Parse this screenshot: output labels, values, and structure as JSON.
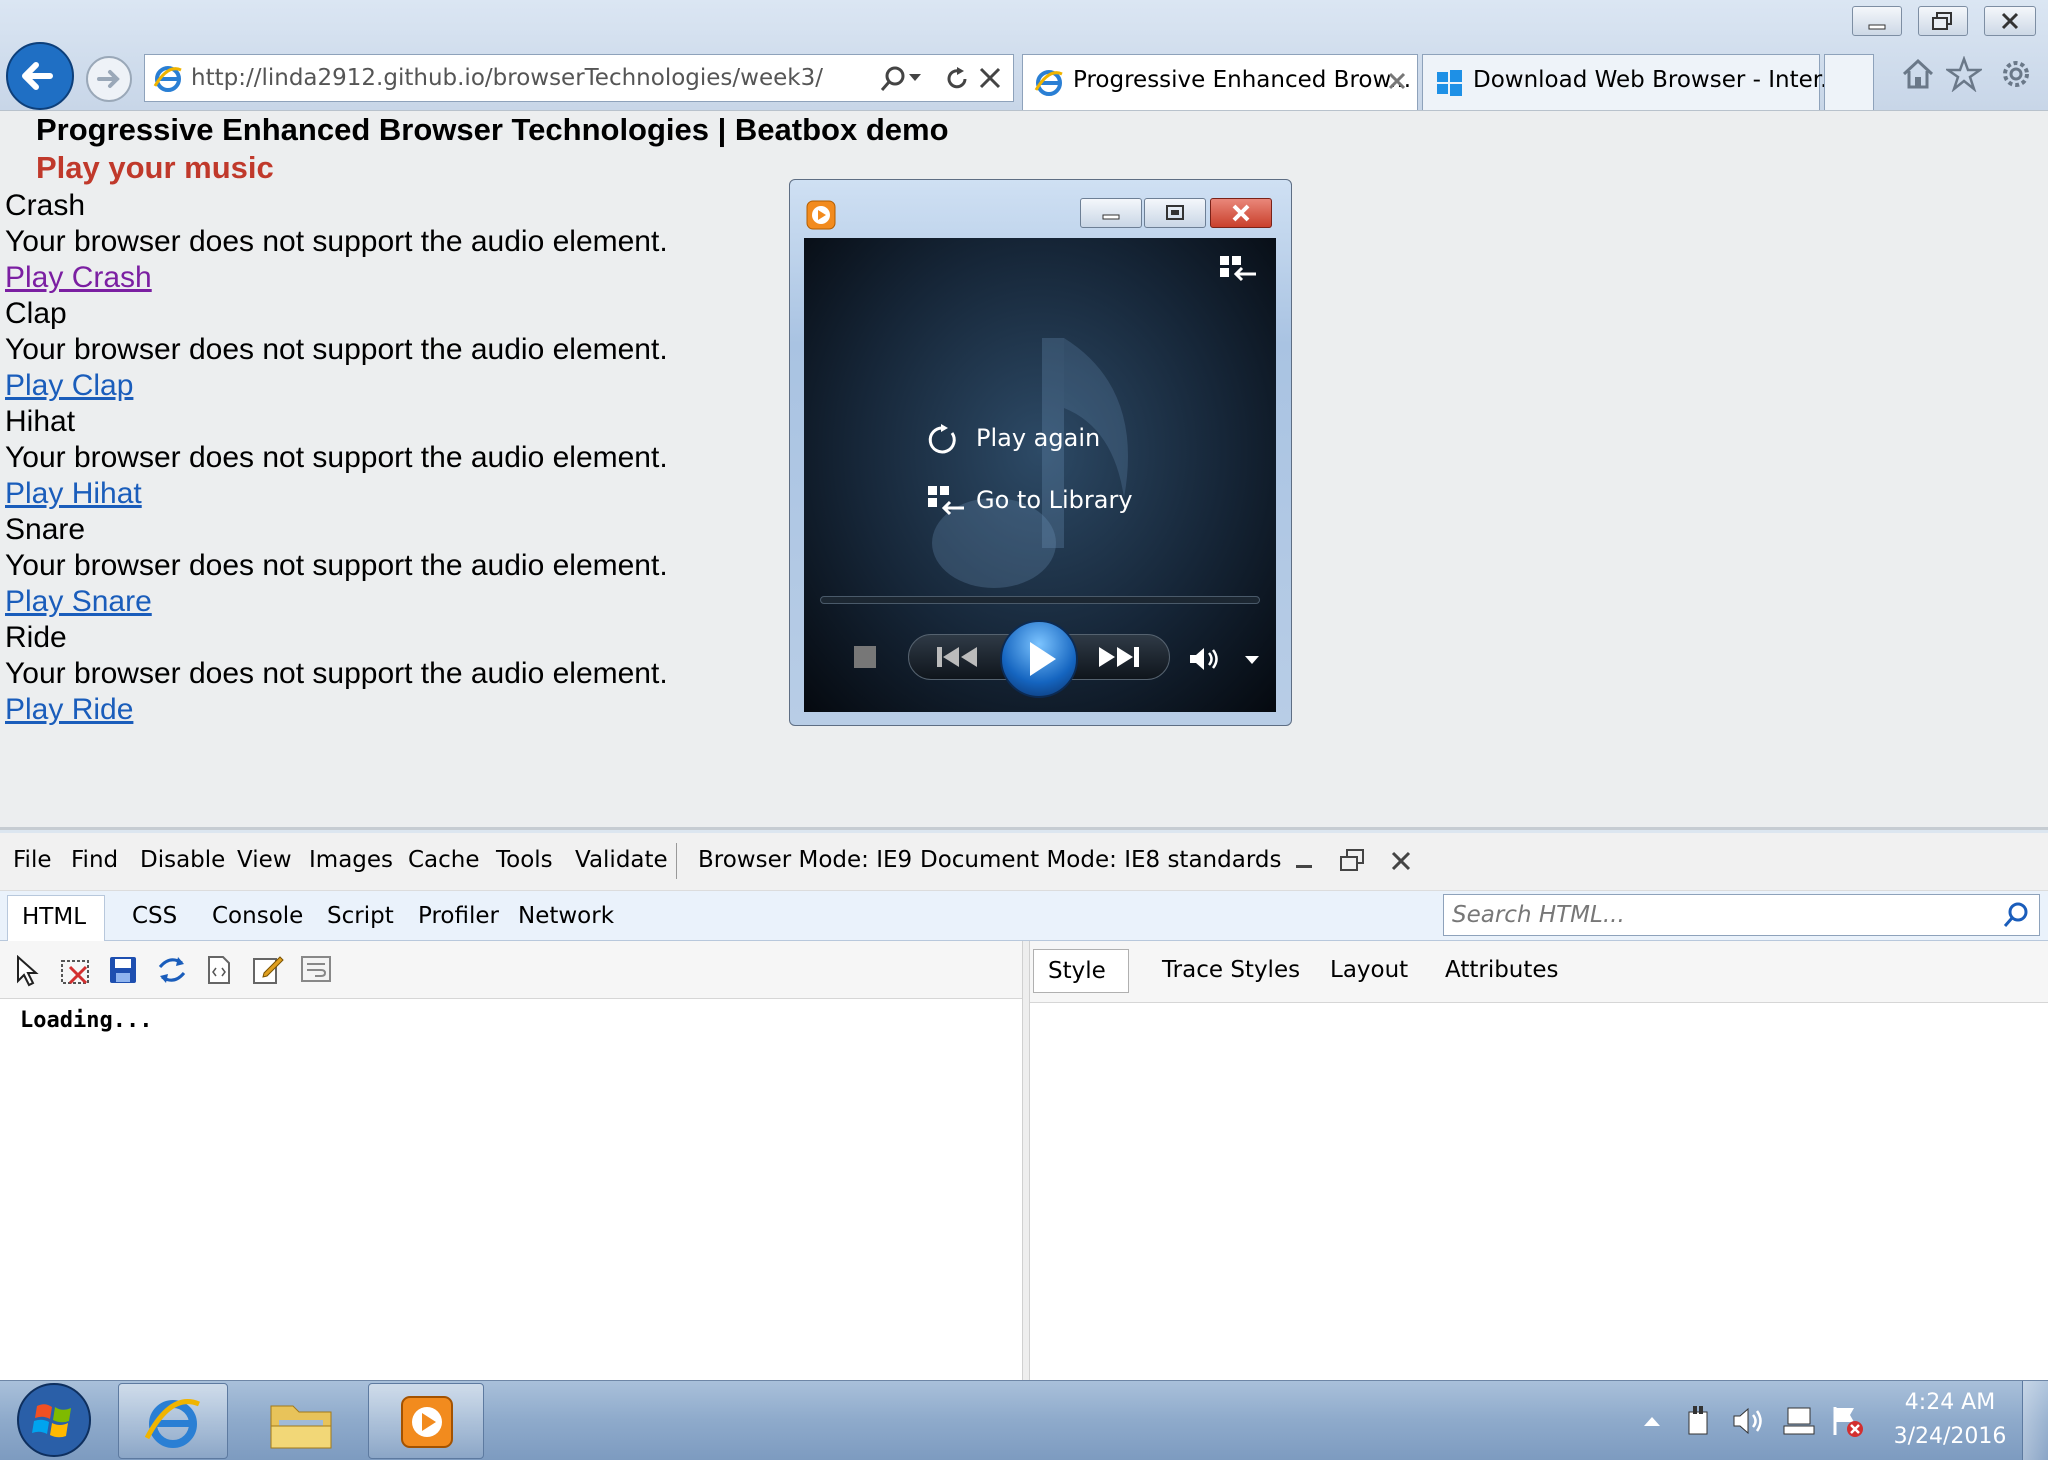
{
  "browser": {
    "address_url": "http://linda2912.github.io/browserTechnologies/week3/",
    "tabs": [
      {
        "title": "Progressive Enhanced Brow...",
        "active": true
      },
      {
        "title": "Download Web Browser - Inter...",
        "active": false
      }
    ]
  },
  "page": {
    "heading": "Progressive Enhanced Browser Technologies | Beatbox demo",
    "subheading": "Play your music",
    "sounds": [
      {
        "name": "Crash",
        "fallback": "Your browser does not support the audio element.",
        "link": "Play Crash"
      },
      {
        "name": "Clap",
        "fallback": "Your browser does not support the audio element.",
        "link": "Play Clap"
      },
      {
        "name": "Hihat",
        "fallback": "Your browser does not support the audio element.",
        "link": "Play Hihat"
      },
      {
        "name": "Snare",
        "fallback": "Your browser does not support the audio element.",
        "link": "Play Snare"
      },
      {
        "name": "Ride",
        "fallback": "Your browser does not support the audio element.",
        "link": "Play Ride"
      }
    ]
  },
  "media_player": {
    "play_again": "Play again",
    "go_to_library": "Go to Library"
  },
  "devtools": {
    "menu": [
      "File",
      "Find",
      "Disable",
      "View",
      "Images",
      "Cache",
      "Tools",
      "Validate"
    ],
    "browser_mode": "Browser Mode:  IE9",
    "document_mode": "Document Mode:  IE8 standards",
    "tabs": [
      "HTML",
      "CSS",
      "Console",
      "Script",
      "Profiler",
      "Network"
    ],
    "search_placeholder": "Search HTML...",
    "right_tabs": [
      "Style",
      "Trace Styles",
      "Layout",
      "Attributes"
    ],
    "loading_text": "Loading..."
  },
  "taskbar": {
    "time": "4:24 AM",
    "date": "3/24/2016"
  },
  "colors": {
    "subheading": "#c0392b",
    "link": "#1a5dbb",
    "visited_link": "#7b1fa2"
  }
}
